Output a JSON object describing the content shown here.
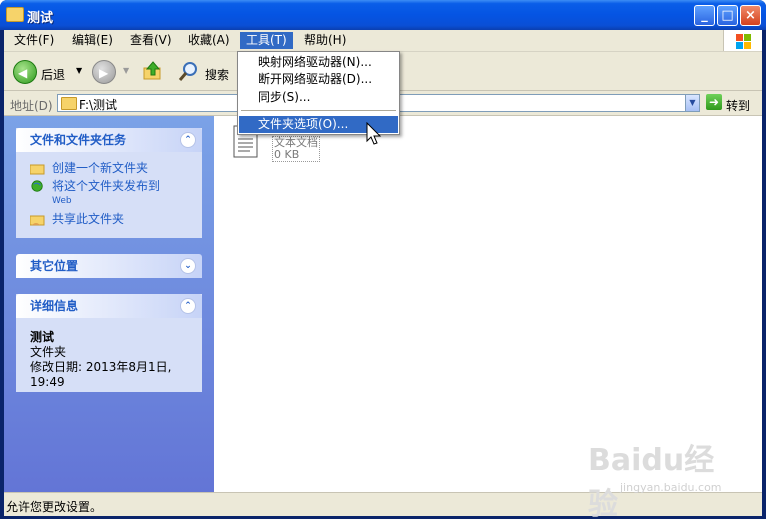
{
  "window": {
    "title": "测试"
  },
  "menubar": [
    {
      "label": "文件(F)"
    },
    {
      "label": "编辑(E)"
    },
    {
      "label": "查看(V)"
    },
    {
      "label": "收藏(A)"
    },
    {
      "label": "工具(T)"
    },
    {
      "label": "帮助(H)"
    }
  ],
  "tools_menu": [
    {
      "label": "映射网络驱动器(N)..."
    },
    {
      "label": "断开网络驱动器(D)..."
    },
    {
      "label": "同步(S)..."
    },
    {
      "label": "文件夹选项(O)..."
    }
  ],
  "toolbar": {
    "back_label": "后退",
    "search_label": "搜索"
  },
  "address": {
    "label": "地址(D)",
    "value": "F:\\测试",
    "go_label": "转到"
  },
  "left_pane": {
    "tasks_header": "文件和文件夹任务",
    "tasks": [
      {
        "label": "创建一个新文件夹",
        "sub": ""
      },
      {
        "label": "将这个文件夹发布到",
        "sub": "Web"
      },
      {
        "label": "共享此文件夹",
        "sub": ""
      }
    ],
    "other_header": "其它位置",
    "details_header": "详细信息",
    "details": {
      "name": "测试",
      "type": "文件夹",
      "modified": "修改日期: 2013年8月1日,",
      "time": "19:49"
    }
  },
  "files": [
    {
      "name": "文本文档",
      "size": "0 KB"
    }
  ],
  "status": {
    "text": "允许您更改设置。"
  },
  "watermark": {
    "text": "Baidu经验",
    "sub": "jingyan.baidu.com"
  },
  "colors": {
    "title_blue": "#0554e3",
    "menu_highlight": "#316ac5",
    "task_blue": "#215dc6"
  }
}
